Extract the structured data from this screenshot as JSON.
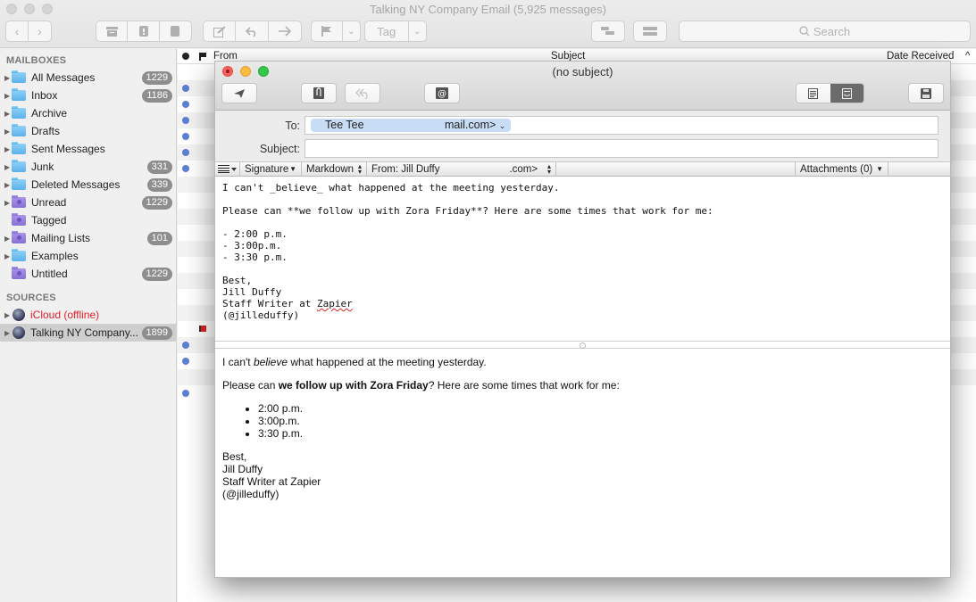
{
  "window": {
    "title": "Talking NY Company Email (5,925 messages)",
    "search_placeholder": "Search",
    "toolbar": {
      "back": "‹",
      "forward": "›",
      "archive_icon": "archive-icon",
      "junk_icon": "junk-icon",
      "trash_icon": "trash-icon",
      "compose_icon": "compose-icon",
      "reply_icon": "reply-icon",
      "forward_icon": "forward-icon",
      "flag_icon": "flag-icon",
      "tag_label": "Tag",
      "chevron": "⌄"
    }
  },
  "sidebar": {
    "mailboxes_header": "MAILBOXES",
    "mailboxes": [
      {
        "label": "All Messages",
        "count": "1229",
        "color": "blue",
        "expand": true
      },
      {
        "label": "Inbox",
        "count": "1186",
        "color": "blue",
        "expand": true
      },
      {
        "label": "Archive",
        "count": "",
        "color": "blue",
        "expand": true
      },
      {
        "label": "Drafts",
        "count": "",
        "color": "blue",
        "expand": true
      },
      {
        "label": "Sent Messages",
        "count": "",
        "color": "blue",
        "expand": true
      },
      {
        "label": "Junk",
        "count": "331",
        "color": "blue",
        "expand": true
      },
      {
        "label": "Deleted Messages",
        "count": "339",
        "color": "blue",
        "expand": true
      },
      {
        "label": "Unread",
        "count": "1229",
        "color": "purple",
        "expand": true
      },
      {
        "label": "Tagged",
        "count": "",
        "color": "purple",
        "expand": false
      },
      {
        "label": "Mailing Lists",
        "count": "101",
        "color": "purple",
        "expand": true
      },
      {
        "label": "Examples",
        "count": "",
        "color": "blue",
        "expand": true
      },
      {
        "label": "Untitled",
        "count": "1229",
        "color": "purple",
        "expand": false
      }
    ],
    "sources_header": "SOURCES",
    "sources": [
      {
        "label": "iCloud (offline)",
        "count": "",
        "status_color": "#e0202a"
      },
      {
        "label": "Talking NY Company...",
        "count": "1899",
        "selected": true
      }
    ]
  },
  "message_list": {
    "columns": {
      "from": "From",
      "subject": "Subject",
      "date": "Date Received",
      "sort_icon": "^"
    }
  },
  "compose": {
    "title": "(no subject)",
    "buttons": {
      "send_icon": "send-icon",
      "attach_icon": "attachment-icon",
      "reply_icon": "reply-icon",
      "address_icon": "address-book-icon",
      "save_icon": "save-icon"
    },
    "to_label": "To:",
    "to_token_name": "Tee Tee",
    "to_token_tail": "mail.com>",
    "subject_label": "Subject:",
    "subject_value": "",
    "options": {
      "signature": "Signature",
      "format": "Markdown",
      "from_name": "From: Jill Duffy",
      "from_tail": ".com>",
      "attachments": "Attachments (0)"
    },
    "markdown_source": {
      "line1": "I can't _believe_ what happened at the meeting yesterday.",
      "line2": "Please can **we follow up with Zora Friday**? Here are some times that work for me:",
      "list": [
        "- 2:00 p.m.",
        "- 3:00p.m.",
        "- 3:30 p.m."
      ],
      "sig1": "Best,",
      "sig2": "Jill Duffy",
      "sig3_pre": "Staff Writer at ",
      "sig3_word": "Zapier",
      "sig4": "(@jilleduffy)"
    },
    "preview": {
      "p1_pre": "I can't ",
      "p1_em": "believe",
      "p1_post": " what happened at the meeting yesterday.",
      "p2_pre": "Please can ",
      "p2_bold": "we follow up with Zora Friday",
      "p2_post": "? Here are some times that work for me:",
      "list": [
        "2:00 p.m.",
        "3:00p.m.",
        "3:30 p.m."
      ],
      "sig": [
        "Best,",
        "Jill Duffy",
        "Staff Writer at Zapier",
        "(@jilleduffy)"
      ]
    }
  }
}
